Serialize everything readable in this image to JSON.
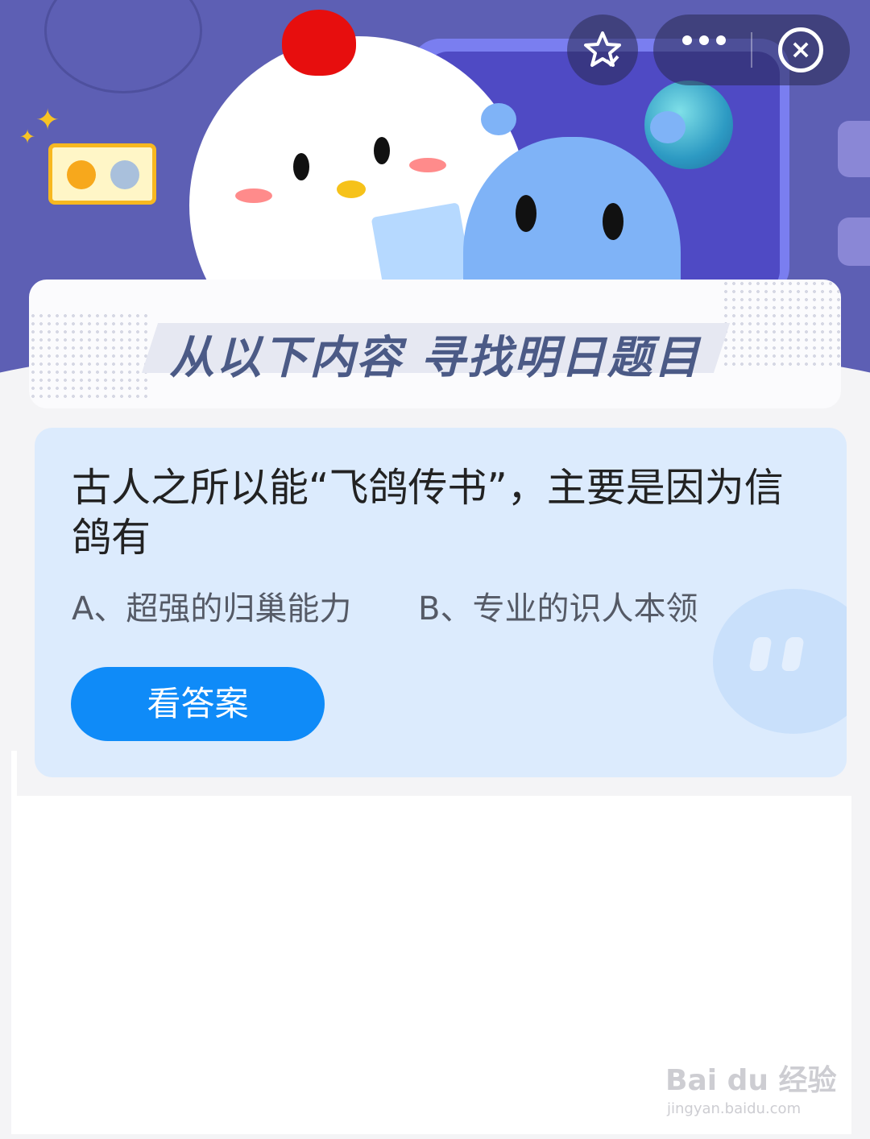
{
  "banner": {
    "title": "从以下内容  寻找明日题目"
  },
  "question": {
    "text": "古人之所以能“飞鸽传书”，主要是因为信鸽有",
    "options": [
      "A、超强的归巢能力",
      "B、专业的识人本领"
    ],
    "answer_button": "看答案"
  },
  "topbar": {
    "favorite_icon": "star-check-icon",
    "more_icon": "more-dots-icon",
    "close_icon": "close-circle-icon"
  },
  "watermark": {
    "brand": "Bai du 经验",
    "url": "jingyan.baidu.com"
  },
  "colors": {
    "hero_bg": "#5d5fb4",
    "card_bg": "#dcebfd",
    "button": "#0f8bf8"
  }
}
